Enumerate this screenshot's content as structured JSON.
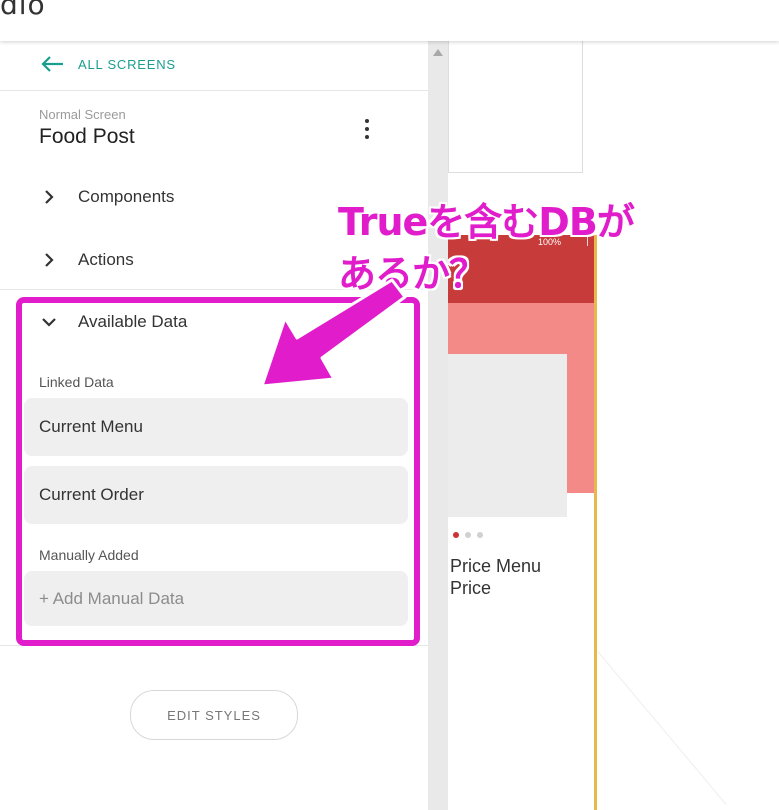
{
  "header": {
    "logo_fragment": "dio"
  },
  "panel": {
    "back_label": "ALL SCREENS",
    "screen_type": "Normal Screen",
    "screen_name": "Food Post",
    "sections": [
      {
        "label": "Components",
        "expanded": false
      },
      {
        "label": "Actions",
        "expanded": false
      },
      {
        "label": "Available Data",
        "expanded": true
      }
    ],
    "linked_data_label": "Linked Data",
    "linked_data": [
      "Current Menu",
      "Current Order"
    ],
    "manually_added_label": "Manually Added",
    "add_manual_placeholder": "+ Add Manual Data",
    "edit_styles_label": "EDIT STYLES"
  },
  "preview": {
    "status_text": "100%",
    "status_mark": "|",
    "carousel": {
      "total": 3,
      "active": 0
    },
    "title": "Price Menu\nPrice"
  },
  "annotation": {
    "text": "Trueを含むDBが\nあるか？"
  },
  "colors": {
    "accent": "#1a9e8f",
    "annotation": "#e01ccb",
    "header_red": "#c73b3b",
    "hero_pink": "#f48a88"
  },
  "icons": [
    "back-arrow-icon",
    "chevron-right-icon",
    "chevron-down-icon",
    "more-vert-icon"
  ]
}
